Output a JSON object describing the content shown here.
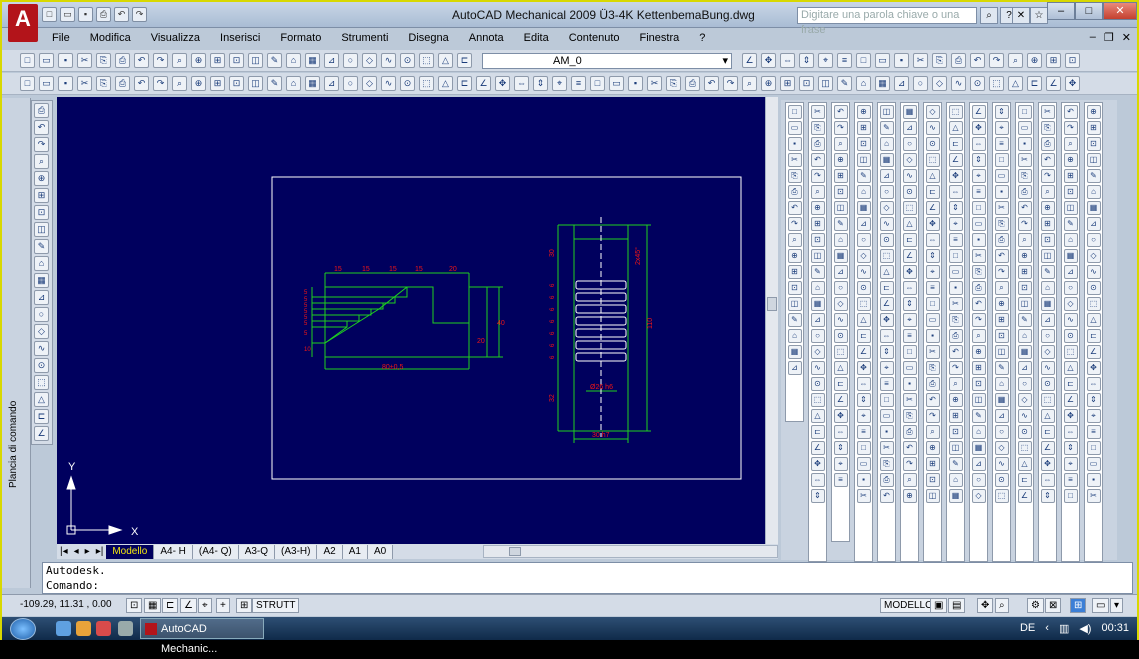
{
  "window": {
    "title": "AutoCAD Mechanical 2009 Ü3-4K KettenbemaBung.dwg",
    "search_placeholder": "Digitare una parola chiave o una frase"
  },
  "menu": [
    "File",
    "Modifica",
    "Visualizza",
    "Inserisci",
    "Formato",
    "Strumenti",
    "Disegna",
    "Annota",
    "Edita",
    "Contenuto",
    "Finestra",
    "?"
  ],
  "toolbar": {
    "layer_name": "AM_0"
  },
  "palette": {
    "label": "Plancia di comando"
  },
  "drawing": {
    "front_dims_top": [
      "15",
      "15",
      "15",
      "15",
      "20"
    ],
    "front_dims_left": [
      "5",
      "5",
      "5",
      "5",
      "5",
      "5",
      "5",
      "10"
    ],
    "front_dim_bottom": "80±0,5",
    "front_dim_right_a": "40",
    "front_dim_right_b": "20",
    "side_dim_top_left": "30",
    "side_dim_top_right": "2x45°",
    "side_dims_left": [
      "6",
      "6",
      "6",
      "6",
      "6",
      "6",
      "6"
    ],
    "side_dim_right": "110",
    "side_dim_diameter": "Ø26 h6",
    "side_dim_bottom_left": "32",
    "side_dim_bottom": "30 h7",
    "ucs_x": "X",
    "ucs_y": "Y"
  },
  "layout_tabs": [
    "Modello",
    "A4- H",
    "(A4- Q)",
    "A3-Q",
    "(A3-H)",
    "A2",
    "A1",
    "A0"
  ],
  "command": {
    "line1": "Autodesk.",
    "line2": "Comando:"
  },
  "status": {
    "coords": "-109.29, 11.31 , 0.00",
    "strutt": "STRUTT",
    "modello": "MODELLO"
  },
  "taskbar": {
    "task_label": "AutoCAD Mechanic...",
    "lang": "DE",
    "time": "00:31"
  },
  "colors": {
    "canvas": "#00005e",
    "green": "#1fd01f",
    "dim": "#f01515",
    "white": "#ffffff"
  }
}
